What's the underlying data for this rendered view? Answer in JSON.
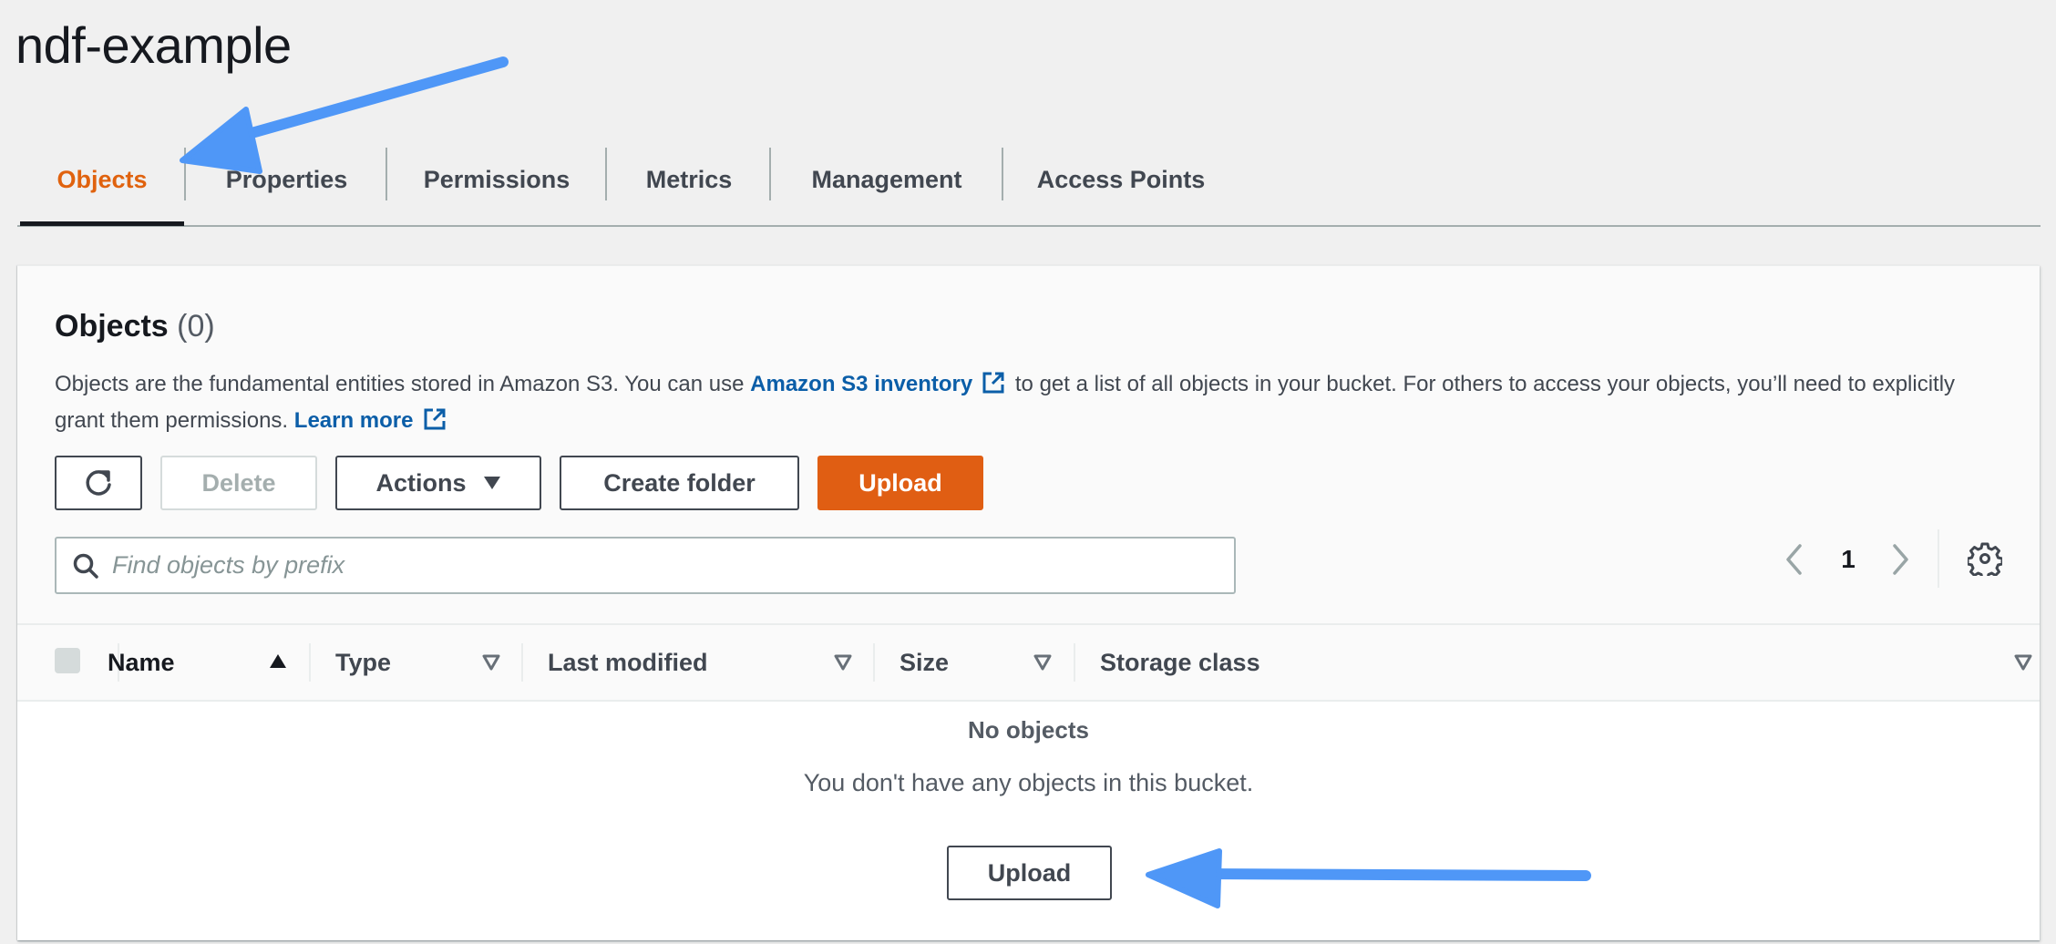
{
  "page": {
    "title": "ndf-example"
  },
  "tabs": [
    {
      "label": "Objects",
      "active": true
    },
    {
      "label": "Properties",
      "active": false
    },
    {
      "label": "Permissions",
      "active": false
    },
    {
      "label": "Metrics",
      "active": false
    },
    {
      "label": "Management",
      "active": false
    },
    {
      "label": "Access Points",
      "active": false
    }
  ],
  "objects_panel": {
    "heading": "Objects",
    "count": "(0)",
    "description": {
      "part1": "Objects are the fundamental entities stored in Amazon S3. You can use ",
      "inventory_link": "Amazon S3 inventory",
      "part2": " to get a list of all objects in your bucket. For others to access your objects, you’ll need to explicitly grant them permissions. ",
      "learn_more_link": "Learn more"
    },
    "toolbar": {
      "refresh_icon": "refresh-icon",
      "delete_label": "Delete",
      "actions_label": "Actions",
      "create_folder_label": "Create folder",
      "upload_label": "Upload"
    },
    "search": {
      "placeholder": "Find objects by prefix",
      "value": ""
    },
    "pagination": {
      "current_page": "1"
    },
    "table": {
      "columns": [
        {
          "label": "Name",
          "sort": "ascending"
        },
        {
          "label": "Type",
          "sort": "none"
        },
        {
          "label": "Last modified",
          "sort": "none"
        },
        {
          "label": "Size",
          "sort": "none"
        },
        {
          "label": "Storage class",
          "sort": "none"
        }
      ],
      "rows": [],
      "empty_state": {
        "title": "No objects",
        "message": "You don't have any objects in this bucket.",
        "upload_label": "Upload"
      }
    }
  },
  "colors": {
    "accent_orange": "#e05e13",
    "active_tab": "#e0620e",
    "link_blue": "#0b5ea8",
    "annotation_arrow": "#4f97f7"
  }
}
